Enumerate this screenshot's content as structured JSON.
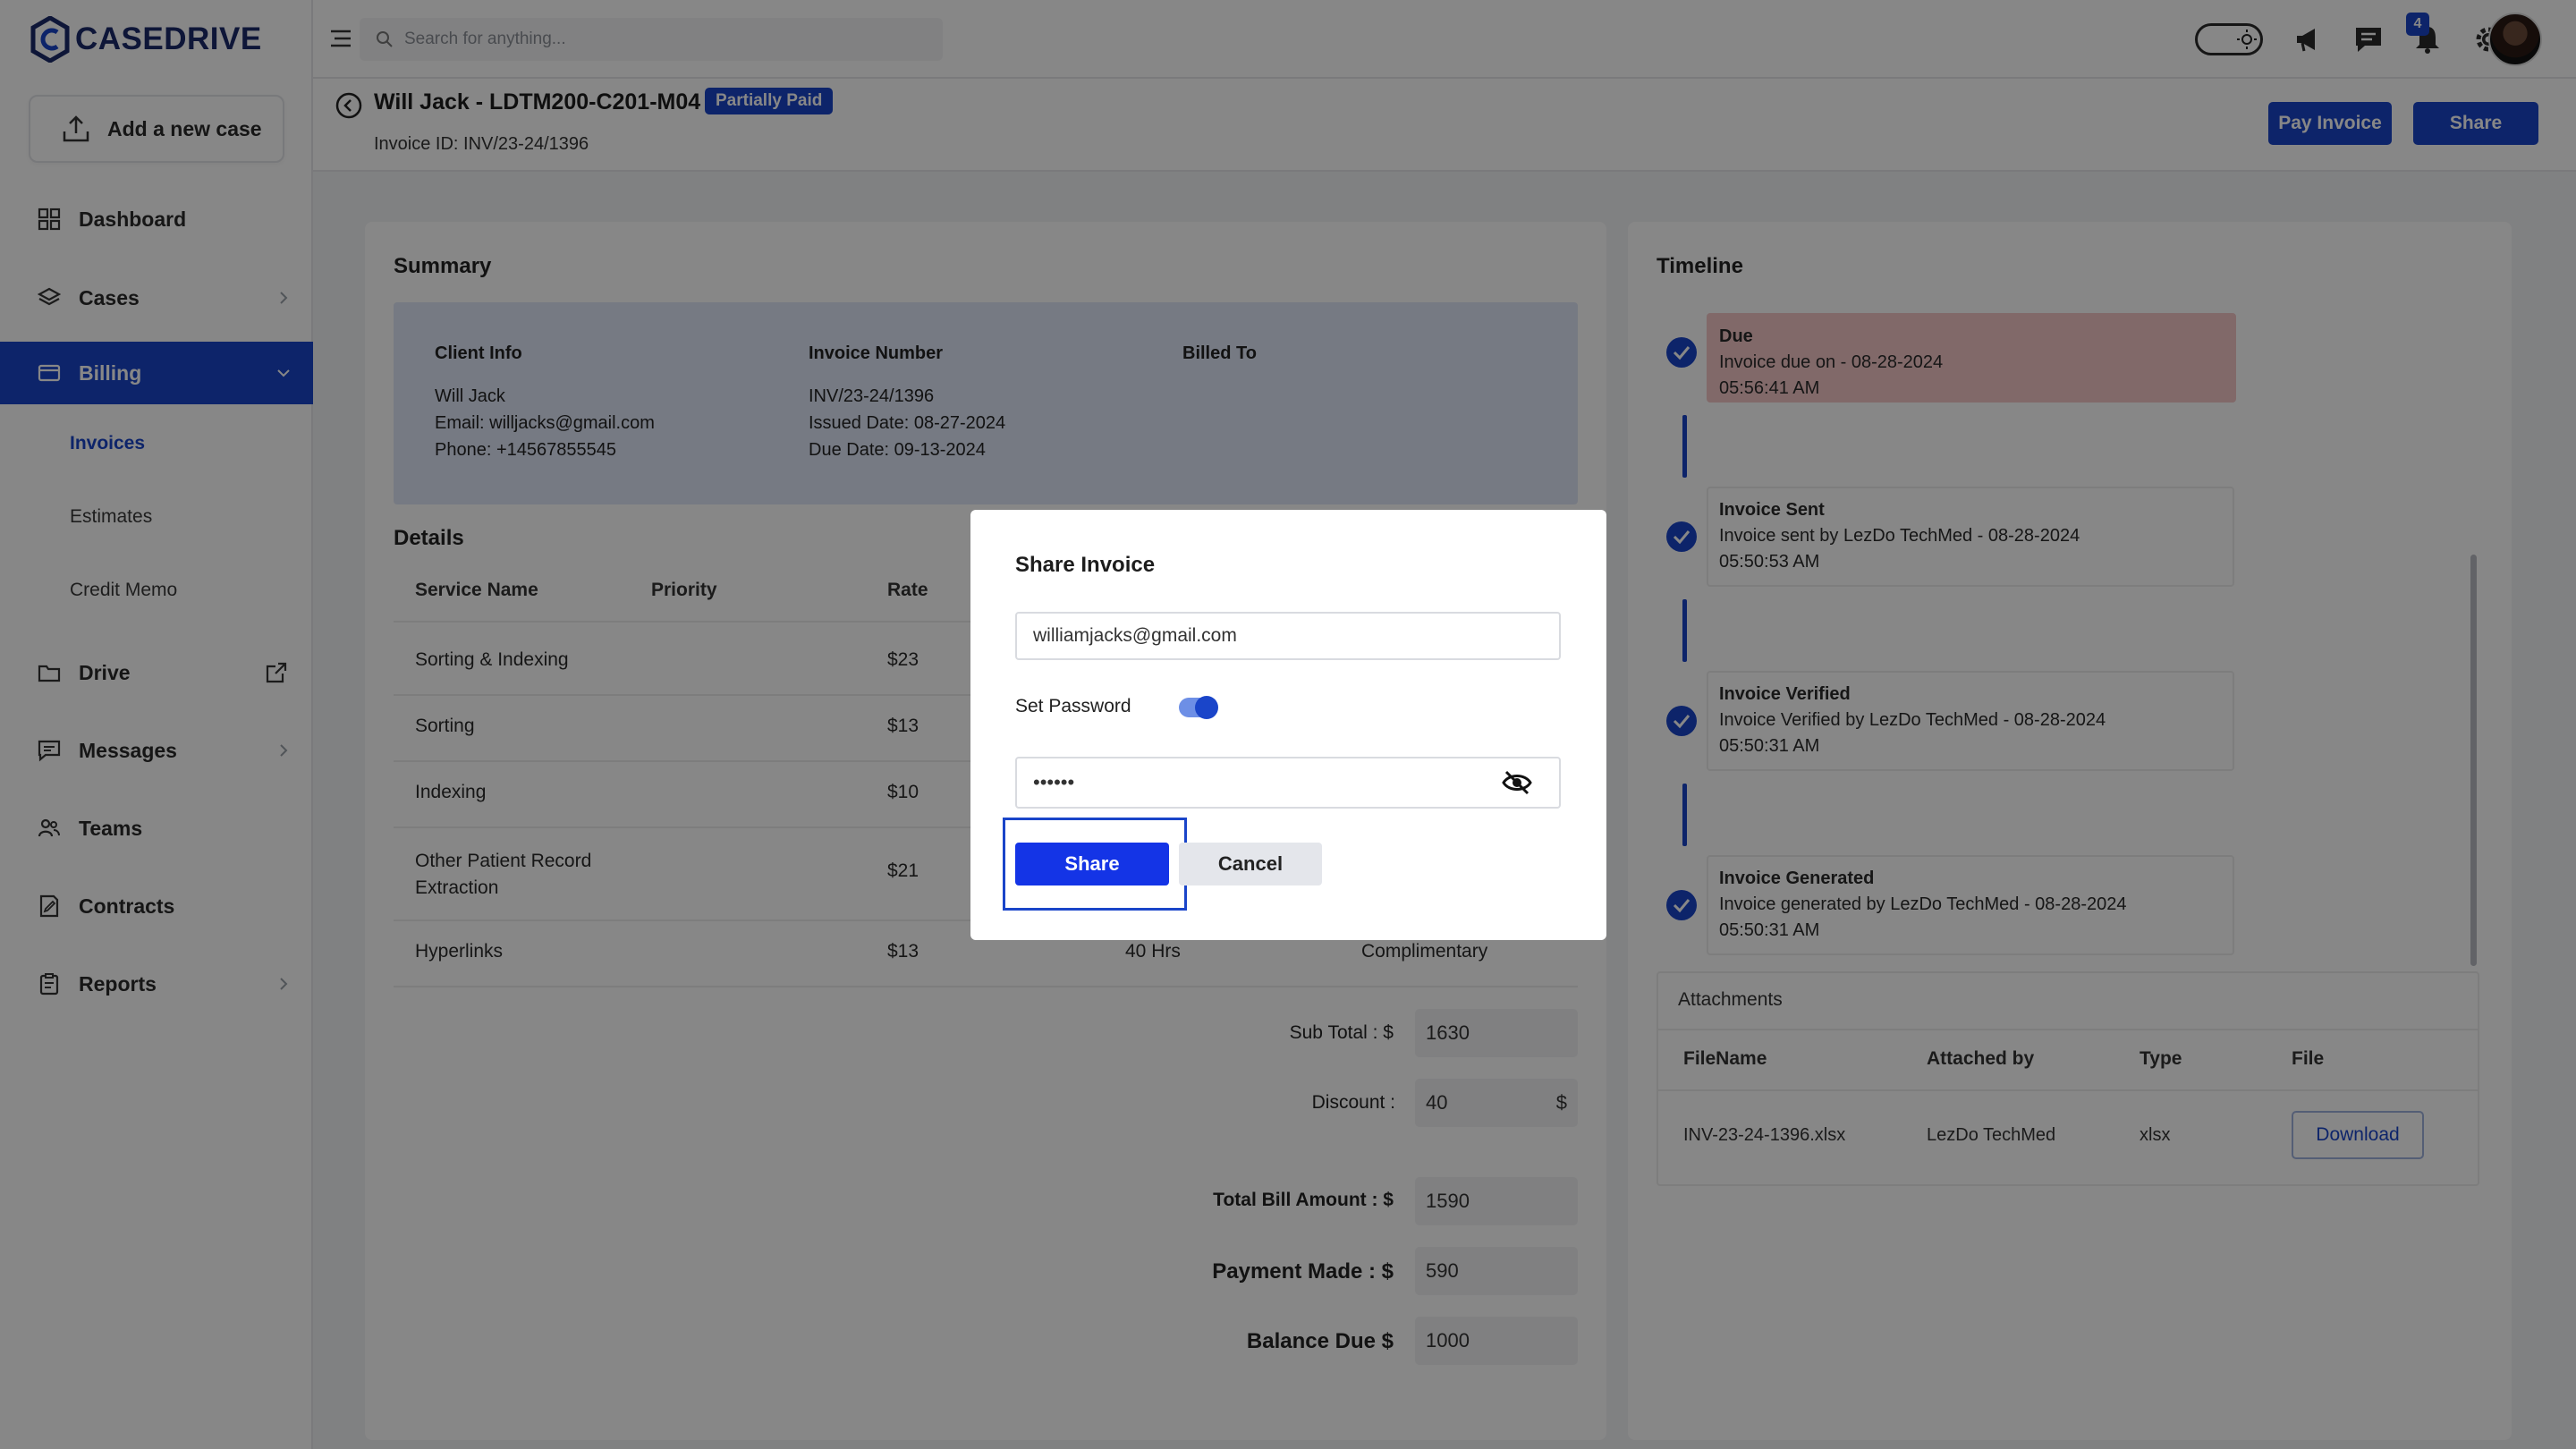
{
  "app": {
    "name": "CASEDRIVE"
  },
  "sidebar": {
    "add_case": "Add a new case",
    "items": [
      {
        "label": "Dashboard",
        "icon": "dashboard-icon"
      },
      {
        "label": "Cases",
        "icon": "layers-icon"
      },
      {
        "label": "Billing",
        "icon": "billing-icon"
      },
      {
        "label": "Drive",
        "icon": "folder-icon"
      },
      {
        "label": "Messages",
        "icon": "message-icon"
      },
      {
        "label": "Teams",
        "icon": "team-icon"
      },
      {
        "label": "Contracts",
        "icon": "contract-icon"
      },
      {
        "label": "Reports",
        "icon": "report-icon"
      }
    ],
    "billing_sub": [
      "Invoices",
      "Estimates",
      "Credit Memo"
    ],
    "active_item": "Billing",
    "active_sub": "Invoices"
  },
  "topbar": {
    "search_placeholder": "Search for anything...",
    "notification_count": "4"
  },
  "header": {
    "title": "Will Jack - LDTM200-C201-M04",
    "status": "Partially Paid",
    "invoice_id": "Invoice ID: INV/23-24/1396",
    "pay_invoice": "Pay Invoice",
    "share": "Share"
  },
  "summary": {
    "title": "Summary",
    "client_info": {
      "heading": "Client Info",
      "name": "Will Jack",
      "email": "Email: willjacks@gmail.com",
      "phone": "Phone: +14567855545"
    },
    "invoice_number": {
      "heading": "Invoice Number",
      "number": "INV/23-24/1396",
      "issued": "Issued Date: 08-27-2024",
      "due": "Due Date: 09-13-2024"
    },
    "billed_to": {
      "heading": "Billed To"
    }
  },
  "details": {
    "title": "Details",
    "columns": [
      "Service Name",
      "Priority",
      "Rate"
    ],
    "rows": [
      {
        "service": "Sorting & Indexing",
        "rate": "$23"
      },
      {
        "service": "Sorting",
        "rate": "$13"
      },
      {
        "service": "Indexing",
        "rate": "$10"
      },
      {
        "service": "Other Patient Record\nExtraction",
        "rate": "$21"
      },
      {
        "service": "Hyperlinks",
        "rate": "$13",
        "hours": "40 Hrs",
        "note": "Complimentary"
      }
    ]
  },
  "totals": {
    "sub_total_label": "Sub Total : $",
    "sub_total": "1630",
    "discount_label": "Discount :",
    "discount": "40",
    "discount_unit": "$",
    "total_label": "Total Bill Amount : $",
    "total": "1590",
    "payment_label": "Payment Made : $",
    "payment": "590",
    "balance_label": "Balance Due $",
    "balance": "1000"
  },
  "timeline": {
    "title": "Timeline",
    "items": [
      {
        "title": "Due",
        "line1": "Invoice due on - 08-28-2024",
        "line2": "05:56:41 AM"
      },
      {
        "title": "Invoice Sent",
        "line1": "Invoice sent by LezDo TechMed - 08-28-2024",
        "line2": "05:50:53 AM"
      },
      {
        "title": "Invoice Verified",
        "line1": "Invoice Verified by LezDo TechMed - 08-28-2024",
        "line2": "05:50:31 AM"
      },
      {
        "title": "Invoice Generated",
        "line1": "Invoice generated by LezDo TechMed - 08-28-2024",
        "line2": "05:50:31 AM"
      }
    ]
  },
  "attachments": {
    "title": "Attachments",
    "columns": [
      "FileName",
      "Attached by",
      "Type",
      "File"
    ],
    "rows": [
      {
        "file": "INV-23-24-1396.xlsx",
        "by": "LezDo TechMed",
        "type": "xlsx",
        "action": "Download"
      }
    ]
  },
  "modal": {
    "title": "Share Invoice",
    "email": "williamjacks@gmail.com",
    "set_password": "Set Password",
    "password_value": "••••••",
    "share": "Share",
    "cancel": "Cancel"
  },
  "colors": {
    "brand": "#1a45c9",
    "due_bg": "#f3c6c6",
    "summary_bg": "#dfe6f7"
  }
}
